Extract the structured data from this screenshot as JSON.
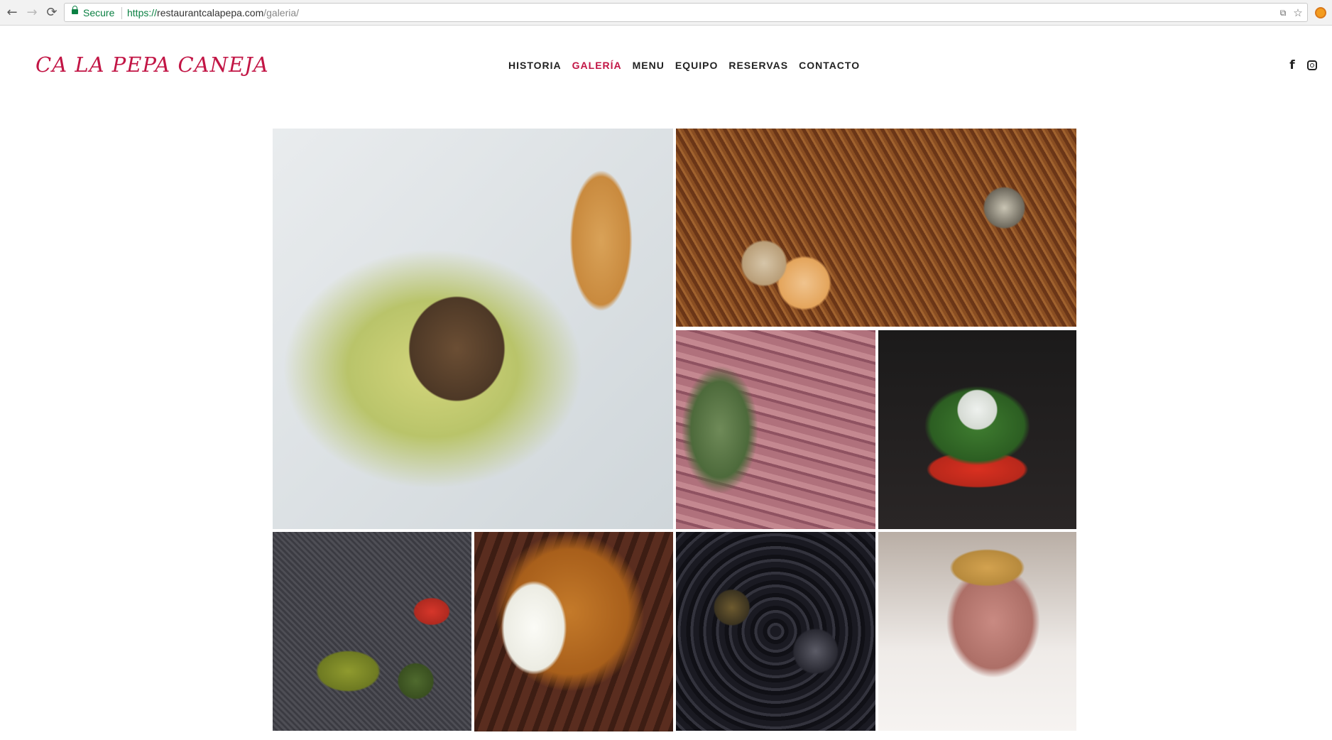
{
  "browser": {
    "secure_label": "Secure",
    "url_scheme": "https://",
    "url_host": "restaurantcalapepa.com",
    "url_path": "/galeria/",
    "icons": [
      "back-icon",
      "forward-icon",
      "reload-icon",
      "lock-icon",
      "translate-icon",
      "star-icon",
      "extension-icon"
    ]
  },
  "site": {
    "logo": "CA LA PEPA CANEJA",
    "brand_color": "#c21545",
    "nav": [
      {
        "label": "HISTORIA",
        "active": false
      },
      {
        "label": "GALERÍA",
        "active": true
      },
      {
        "label": "MENU",
        "active": false
      },
      {
        "label": "EQUIPO",
        "active": false
      },
      {
        "label": "RESERVAS",
        "active": false
      },
      {
        "label": "CONTACTO",
        "active": false
      }
    ],
    "social": {
      "facebook_glyph": "f",
      "icons": [
        "facebook-icon",
        "instagram-icon"
      ]
    }
  },
  "gallery": {
    "photo_count": 8
  }
}
